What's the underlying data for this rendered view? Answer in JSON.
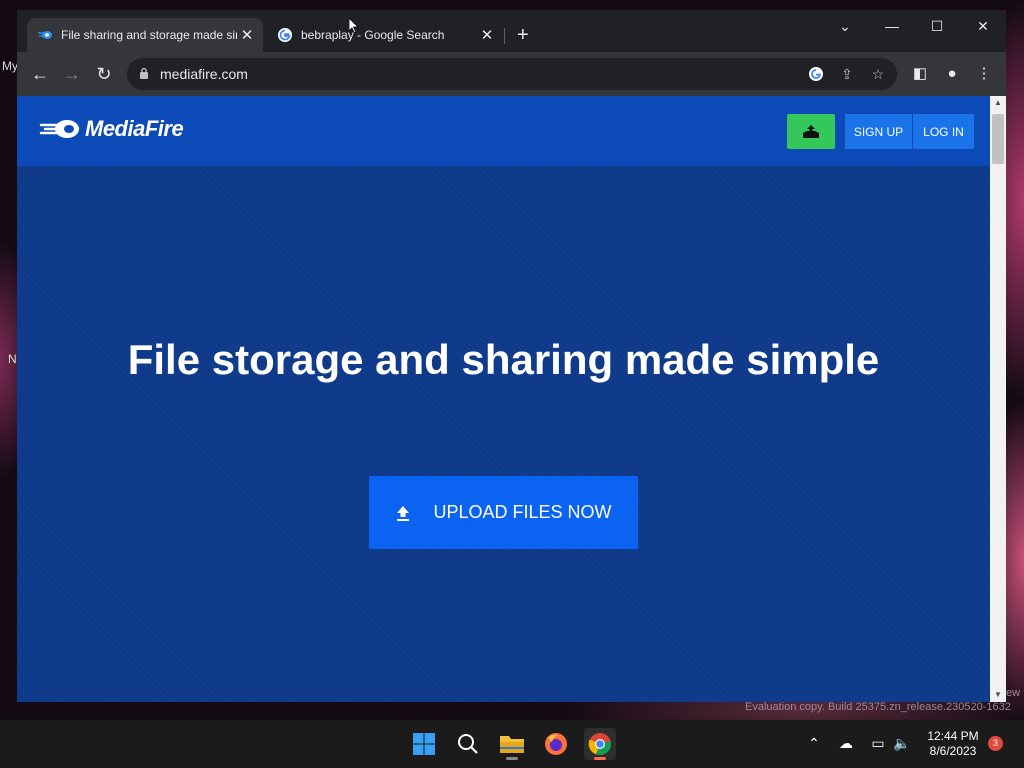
{
  "desktop": {
    "left_texts": [
      "My",
      "N"
    ],
    "watermark": "Evaluation copy. Build 25375.zn_release.230520-1632",
    "watermark_suffix": "ew"
  },
  "browser": {
    "tabs": [
      {
        "title": "File sharing and storage made simple",
        "favicon": "mediafire-favicon",
        "active": true
      },
      {
        "title": "bebraplay - Google Search",
        "favicon": "google-favicon",
        "active": false
      }
    ],
    "new_tab_label": "+",
    "url": "mediafire.com",
    "window_controls": {
      "dropdown": "⌄",
      "minimize": "—",
      "maximize": "☐",
      "close": "✕"
    }
  },
  "page": {
    "brand": "MediaFire",
    "sign_up_label": "SIGN UP",
    "log_in_label": "LOG IN",
    "hero_title": "File storage and sharing made simple",
    "cta_label": "UPLOAD FILES NOW",
    "colors": {
      "header": "#0b4ab7",
      "hero": "#0e3a8c",
      "cta": "#0b63f1",
      "upload_green": "#34c759",
      "auth": "#1a73e8"
    }
  },
  "taskbar": {
    "apps": [
      "windows-start",
      "search",
      "file-explorer",
      "firefox",
      "chrome"
    ],
    "time": "12:44 PM",
    "date": "8/6/2023",
    "notification_count": "3"
  }
}
